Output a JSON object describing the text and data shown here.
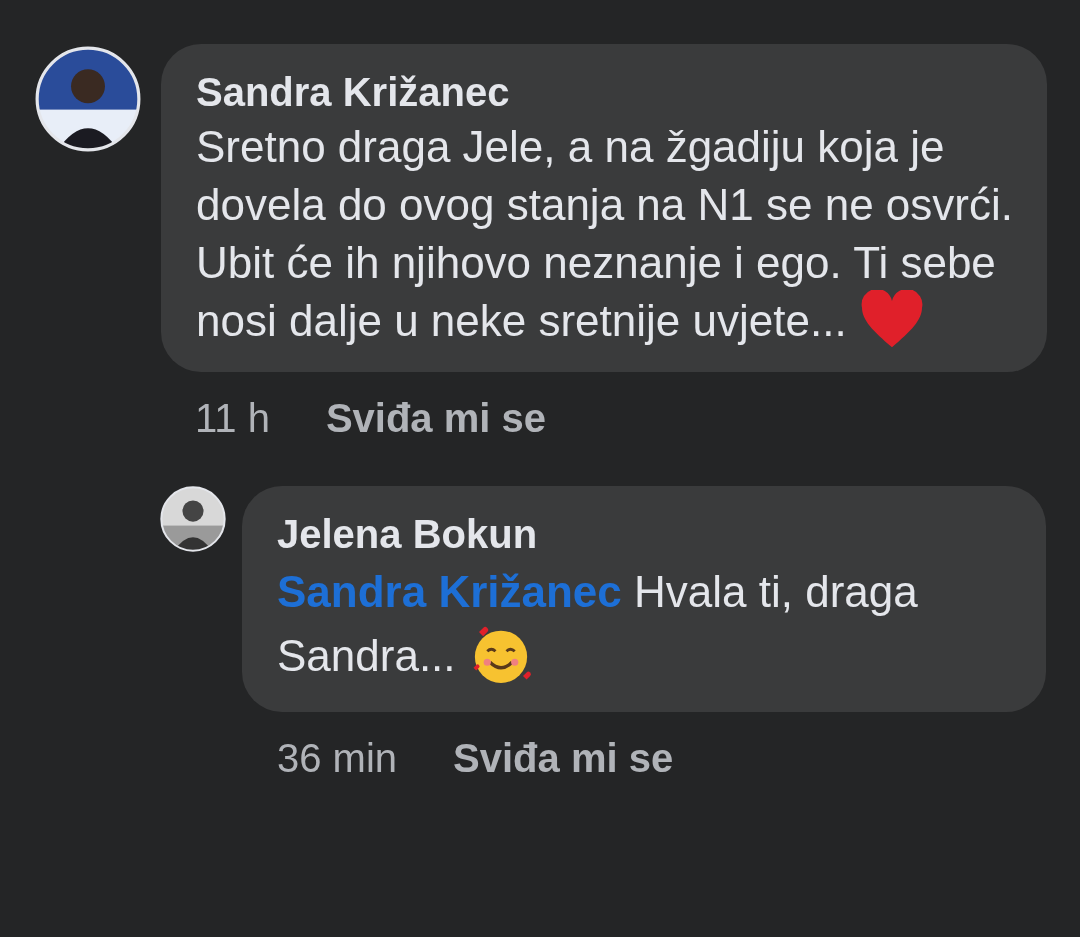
{
  "comments": [
    {
      "author": "Sandra Križanec",
      "text": "Sretno draga Jele, a na žgadiju koja je dovela do ovog stanja na N1 se ne osvrći. Ubit će ih njihovo neznanje i ego. Ti sebe nosi dalje u neke sretnije uvjete...",
      "time": "11 h",
      "like": "Sviđa mi se",
      "replies": [
        {
          "author": "Jelena Bokun",
          "mention": "Sandra Križanec",
          "text": "Hvala ti, draga Sandra...",
          "time": "36 min",
          "like": "Sviđa mi se"
        }
      ]
    }
  ]
}
